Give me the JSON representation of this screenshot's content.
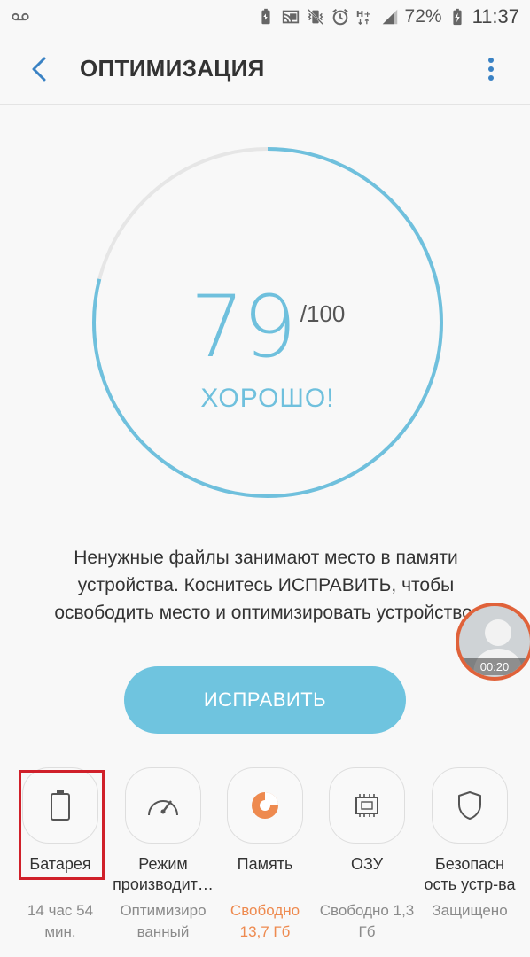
{
  "status_bar": {
    "battery_percent": "72%",
    "time": "11:37",
    "icons": [
      "voicemail-icon",
      "battery-saver-icon",
      "cast-icon",
      "vibrate-icon",
      "alarm-icon",
      "data-hplus-icon",
      "signal-icon",
      "battery-charging-icon"
    ]
  },
  "app_bar": {
    "title": "ОПТИМИЗАЦИЯ"
  },
  "score": {
    "value": "79",
    "max": "/100",
    "fraction": 0.79,
    "status": "ХОРОШО!",
    "accent_color": "#6fc0dd",
    "track_color": "#e6e6e6"
  },
  "description": "Ненужные файлы занимают место в памяти\nустройства. Коснитесь ИСПРАВИТЬ, чтобы\nосвободить место и оптимизировать устройство.",
  "fix_button": {
    "label": "ИСПРАВИТЬ",
    "color": "#6fc4df"
  },
  "video_bubble": {
    "time": "00:20"
  },
  "tiles": [
    {
      "icon": "battery-icon",
      "label": "Батарея",
      "status": "14 час 54\nмин."
    },
    {
      "icon": "speedometer-icon",
      "label": "Режим\nпроизводит…",
      "status": "Оптимизиро\nванный"
    },
    {
      "icon": "storage-pie-icon",
      "label": "Память",
      "status": "Свободно\n13,7 Гб",
      "status_color": "#ee8a4f"
    },
    {
      "icon": "memory-chip-icon",
      "label": "ОЗУ",
      "status": "Свободно 1,3\nГб"
    },
    {
      "icon": "shield-icon",
      "label": "Безопасн\nость устр-ва",
      "status": "Защищено"
    }
  ]
}
